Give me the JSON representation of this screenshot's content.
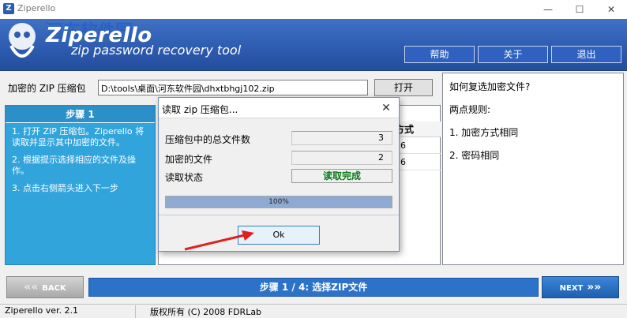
{
  "window": {
    "title": "Ziperello",
    "min": "—",
    "max": "☐",
    "close": "✕"
  },
  "banner": {
    "brand": "Ziperello",
    "tagline": "zip password recovery tool",
    "watermark": "河东软件园",
    "watermark_url": "www.pc0359.cn",
    "buttons": {
      "help": "帮助",
      "about": "关于",
      "exit": "退出"
    },
    "colors": {
      "banner": "#2e5cb0",
      "button": "#2f62c0"
    }
  },
  "file": {
    "label": "加密的 ZIP 压缩包",
    "path": "D:\\tools\\桌面\\河东软件园\\dhxtbhgj102.zip",
    "open_button": "打开"
  },
  "step_panel": {
    "title": "步骤 1",
    "items": [
      "1. 打开 ZIP 压缩包。Ziperello 将读取并显示其中加密的文件。",
      "2. 根据提示选择相应的文件及操作。",
      "3. 点击右侧箭头进入下一步"
    ],
    "color": "#32a4dc"
  },
  "list": {
    "column_header": "方式",
    "cells": [
      "56",
      "56"
    ]
  },
  "info_panel": {
    "lines": [
      "如何复选加密文件?",
      "两点规则:",
      "1. 加密方式相同",
      "2. 密码相同"
    ]
  },
  "nav": {
    "back_label": "BACK",
    "step_text": "步骤 1 / 4: 选择ZIP文件",
    "next_label": "NEXT"
  },
  "status": {
    "version": "Ziperello ver. 2.1",
    "copyright": "版权所有 (C) 2008 FDRLab"
  },
  "dialog": {
    "title": "读取 zip 压缩包...",
    "close": "✕",
    "rows": [
      {
        "label": "压缩包中的总文件数",
        "value": "3"
      },
      {
        "label": "加密的文件",
        "value": "2"
      },
      {
        "label": "读取状态",
        "value": "读取完成"
      }
    ],
    "progress_text": "100%",
    "progress_fraction": 1.0,
    "ok_label": "Ok",
    "status_color": "#0a7a1a"
  },
  "annotation": {
    "arrow_color": "#e02020"
  }
}
